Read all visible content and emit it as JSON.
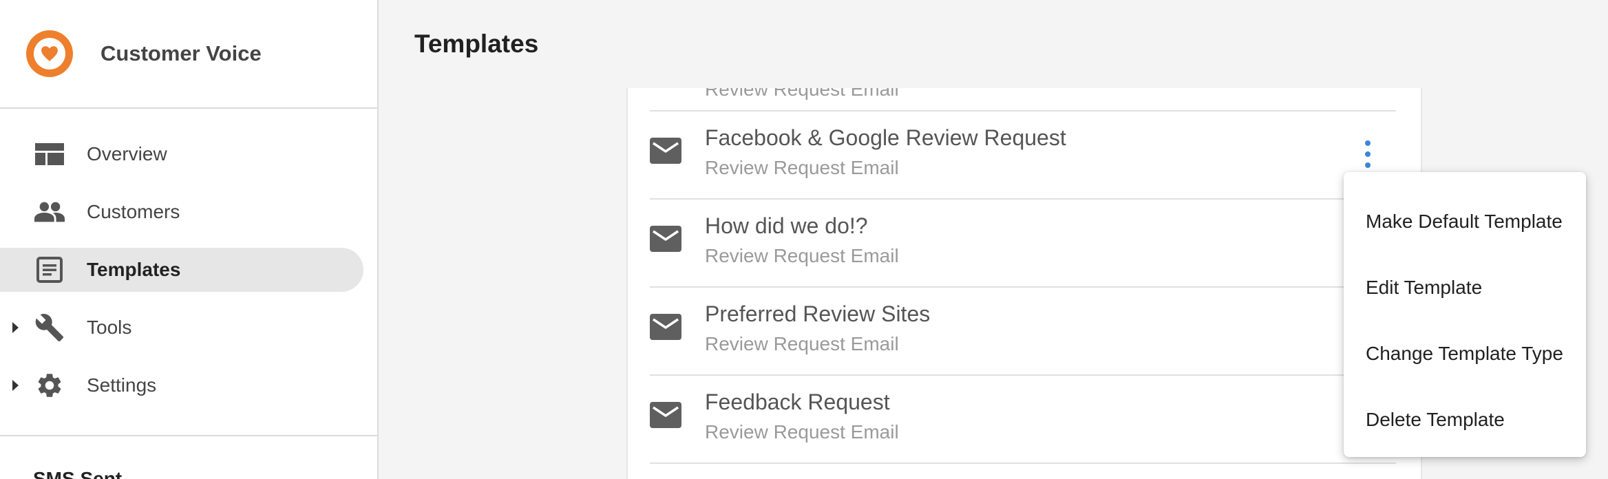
{
  "app": {
    "name": "Customer Voice",
    "brand_color": "#ee7f2d"
  },
  "sidebar": {
    "items": [
      {
        "label": "Overview",
        "icon": "overview-icon",
        "active": false
      },
      {
        "label": "Customers",
        "icon": "people-icon",
        "active": false
      },
      {
        "label": "Templates",
        "icon": "templates-icon",
        "active": true
      },
      {
        "label": "Tools",
        "icon": "wrench-icon",
        "active": false,
        "expandable": true
      },
      {
        "label": "Settings",
        "icon": "gear-icon",
        "active": false,
        "expandable": true
      }
    ],
    "sms_label": "SMS Sent"
  },
  "header": {
    "title": "Templates"
  },
  "templates": [
    {
      "title": "",
      "subtitle": "Review Request Email",
      "icon": "mail-icon",
      "partial": true
    },
    {
      "title": "Facebook & Google Review Request",
      "subtitle": "Review Request Email",
      "icon": "mail-icon"
    },
    {
      "title": "How did we do!?",
      "subtitle": "Review Request Email",
      "icon": "mail-icon"
    },
    {
      "title": "Preferred Review Sites",
      "subtitle": "Review Request Email",
      "icon": "mail-icon"
    },
    {
      "title": "Feedback Request",
      "subtitle": "Review Request Email",
      "icon": "mail-icon"
    }
  ],
  "context_menu": {
    "items": [
      "Make Default Template",
      "Edit Template",
      "Change Template Type",
      "Delete Template"
    ]
  },
  "colors": {
    "accent_blue": "#3b86d6",
    "active_nav_bg": "#e6e6e6",
    "main_bg": "#f4f4f4"
  }
}
